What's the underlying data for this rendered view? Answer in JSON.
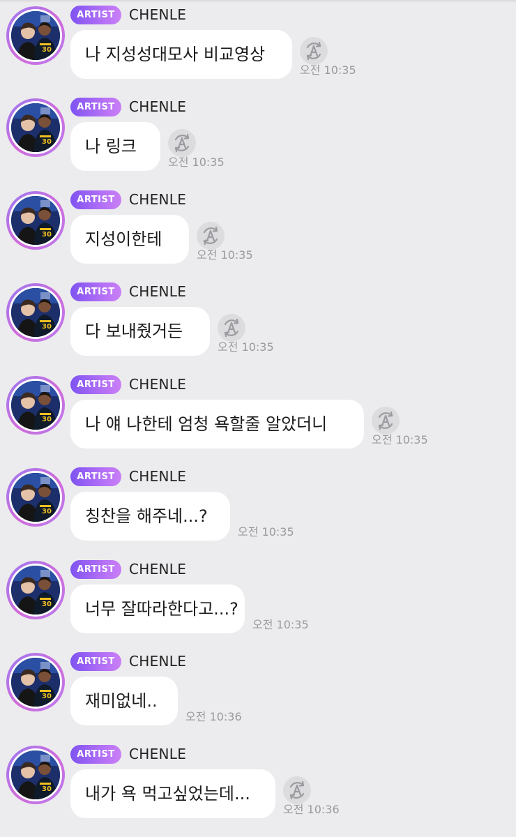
{
  "chat": {
    "messages": [
      {
        "badge": "ARTIST",
        "name": "CHENLE",
        "text": "나 지성성대모사 비교영상",
        "time": "오전 10:35",
        "translate": true
      },
      {
        "badge": "ARTIST",
        "name": "CHENLE",
        "text": "나 링크",
        "time": "오전 10:35",
        "translate": true
      },
      {
        "badge": "ARTIST",
        "name": "CHENLE",
        "text": "지성이한테",
        "time": "오전 10:35",
        "translate": true
      },
      {
        "badge": "ARTIST",
        "name": "CHENLE",
        "text": "다 보내줬거든",
        "time": "오전 10:35",
        "translate": true
      },
      {
        "badge": "ARTIST",
        "name": "CHENLE",
        "text": "나 얘 나한테 엄청 욕할줄 알았더니",
        "time": "오전 10:35",
        "translate": true
      },
      {
        "badge": "ARTIST",
        "name": "CHENLE",
        "text": "칭찬을 해주네...?",
        "time": "오전 10:35",
        "translate": false
      },
      {
        "badge": "ARTIST",
        "name": "CHENLE",
        "text": "너무 잘따라한다고...?",
        "time": "오전 10:35",
        "translate": false
      },
      {
        "badge": "ARTIST",
        "name": "CHENLE",
        "text": "재미없네..",
        "time": "오전 10:36",
        "translate": false
      },
      {
        "badge": "ARTIST",
        "name": "CHENLE",
        "text": "내가 욕 먹고싶었는데...",
        "time": "오전 10:36",
        "translate": true
      }
    ]
  },
  "icons": {
    "avatar": "artist-avatar",
    "translate": "translate-icon"
  },
  "colors": {
    "background": "#ececee",
    "badge_start": "#7f53f2",
    "badge_end": "#c97ff5",
    "bubble": "#ffffff",
    "time": "#9a9a9e"
  }
}
